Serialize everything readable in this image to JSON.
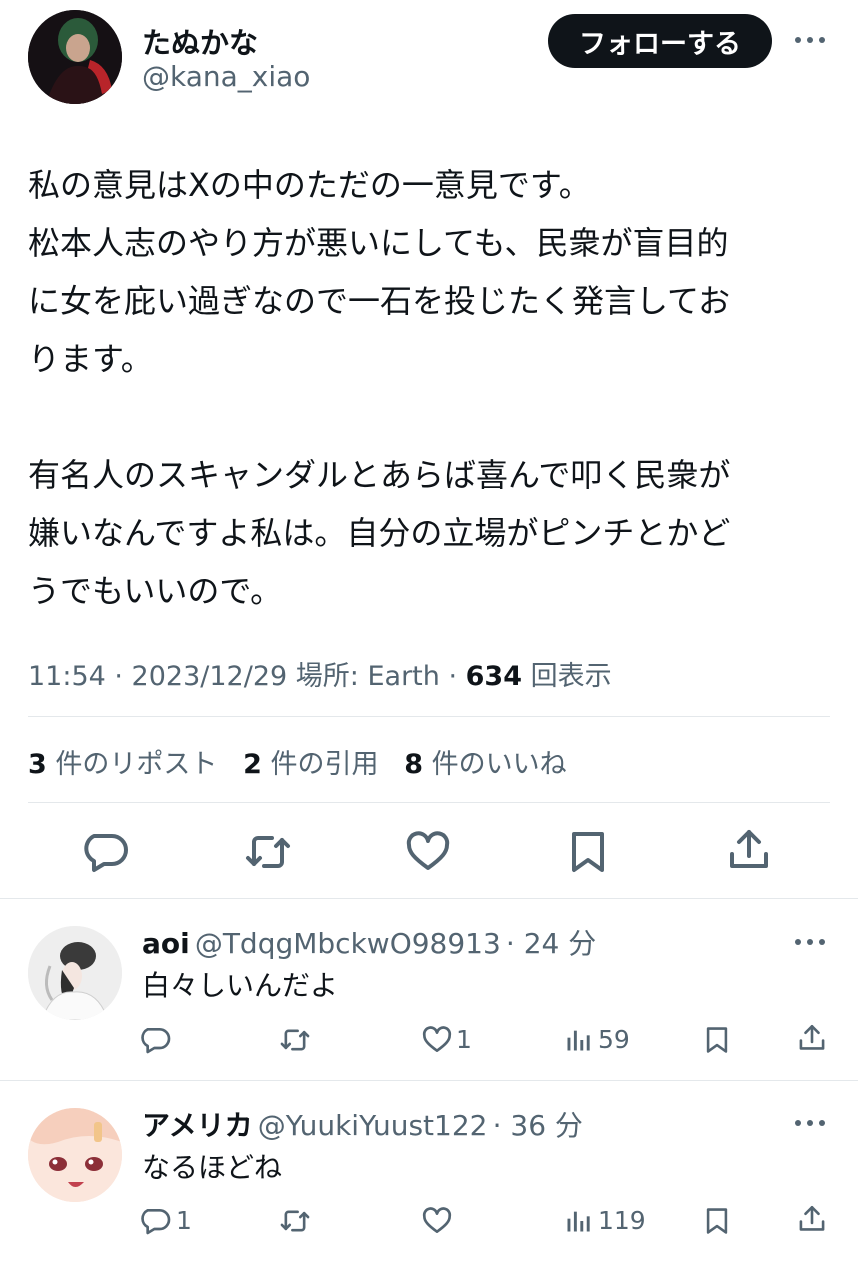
{
  "colors": {
    "text": "#0f1419",
    "muted": "#536471",
    "divider": "#e4e8eb",
    "follow_bg": "#0f1419"
  },
  "tweet": {
    "author_name": "たぬかな",
    "author_handle": "@kana_xiao",
    "follow_label": "フォローする",
    "lines": [
      "私の意見はXの中のただの一意見です。",
      "松本人志のやり方が悪いにしても、民衆が盲目的",
      "に女を庇い過ぎなので一石を投じたく発言してお",
      "ります。",
      "有名人のスキャンダルとあらば喜んで叩く民衆が",
      "嫌いなんですよ私は。自分の立場がピンチとかど",
      "うでもいいので。"
    ],
    "time": "11:54 · 2023/12/29",
    "location": "場所: Earth ·",
    "views_count": "634",
    "views_label": "回表示",
    "reposts_count": "3",
    "reposts_label": "件のリポスト",
    "quotes_count": "2",
    "quotes_label": "件の引用",
    "likes_count": "8",
    "likes_label": "件のいいね"
  },
  "replies": [
    {
      "name": "aoi",
      "handle": "@TdqgMbckwO98913",
      "time": "· 24 分",
      "text": "白々しいんだよ",
      "reply_count": "",
      "like_count": "1",
      "views_count": "59"
    },
    {
      "name": "アメリカ",
      "handle": "@YuukiYuust122",
      "time": "· 36 分",
      "text": "なるほどね",
      "reply_count": "1",
      "like_count": "",
      "views_count": "119"
    }
  ]
}
